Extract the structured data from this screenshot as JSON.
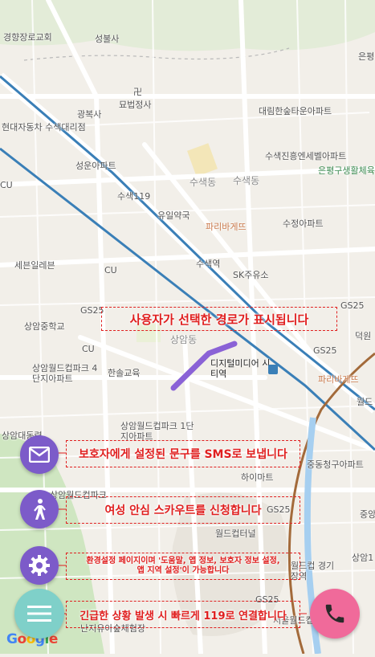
{
  "map": {
    "labels": [
      {
        "text": "경향장로교회"
      },
      {
        "text": "성불사"
      },
      {
        "text": "은평"
      },
      {
        "text": "卍"
      },
      {
        "text": "묘법정사"
      },
      {
        "text": "광복사"
      },
      {
        "text": "대림한숲타운아파트"
      },
      {
        "text": "현대자동차 수색대리점"
      },
      {
        "text": "수색진흥엔세벨아파트"
      },
      {
        "text": "성운아파트"
      },
      {
        "text": "은평구생활체육"
      },
      {
        "text": "CU"
      },
      {
        "text": "수색동"
      },
      {
        "text": "수색동"
      },
      {
        "text": "수색119"
      },
      {
        "text": "유일약국"
      },
      {
        "text": "파리바게뜨"
      },
      {
        "text": "수정아파트"
      },
      {
        "text": "세븐일레븐"
      },
      {
        "text": "CU"
      },
      {
        "text": "수색역"
      },
      {
        "text": "SK주유소"
      },
      {
        "text": "상암중학교"
      },
      {
        "text": "GS25"
      },
      {
        "text": "GS25"
      },
      {
        "text": "덕원"
      },
      {
        "text": "CU"
      },
      {
        "text": "상암동"
      },
      {
        "text": "GS25"
      },
      {
        "text": "상암월드컵파크 4단지아파트"
      },
      {
        "text": "한솔교육"
      },
      {
        "text": "디지털미디어 시티역"
      },
      {
        "text": "파리바게뜨"
      },
      {
        "text": "월드"
      },
      {
        "text": "상암월드컵파크 1단지아파트"
      },
      {
        "text": "상암대동령"
      },
      {
        "text": "중동청구아파트"
      },
      {
        "text": "하이마트"
      },
      {
        "text": "상암월드컵파크"
      },
      {
        "text": "중앙"
      },
      {
        "text": "GS25"
      },
      {
        "text": "월드컵터널"
      },
      {
        "text": "상암1"
      },
      {
        "text": "월드컵 경기장역"
      },
      {
        "text": "GS25"
      },
      {
        "text": "서울월드컵경기장"
      },
      {
        "text": "난지유아숲체험장"
      }
    ],
    "attribution": "Google",
    "colors": {
      "route": "#8a62d6",
      "line6": "#3a7fb7",
      "railway": "#a36a3a"
    }
  },
  "callouts": {
    "route": "사용자가 선택한 경로가 표시됩니다",
    "sms": "보호자에게 설정된 문구를 SMS로 보냅니다",
    "scout": "여성 안심 스카우트를 신청합니다",
    "settings_line1": "환경설정 페이지이며 '도움말, 앱 정보, 보호자 정보 설정,",
    "settings_line2": "앱 지역 설정'이 가능합니다",
    "call": "긴급한 상황 발생 시 빠르게 119로 연결합니다"
  },
  "buttons": {
    "sms_icon": "envelope-icon",
    "scout_icon": "walking-person-icon",
    "settings_icon": "gear-icon",
    "menu_icon": "hamburger-menu-icon",
    "call_icon": "phone-icon",
    "accent_purple": "#7c5bc9",
    "menu_color": "#7fd0c9",
    "call_color": "#f06a9a"
  }
}
